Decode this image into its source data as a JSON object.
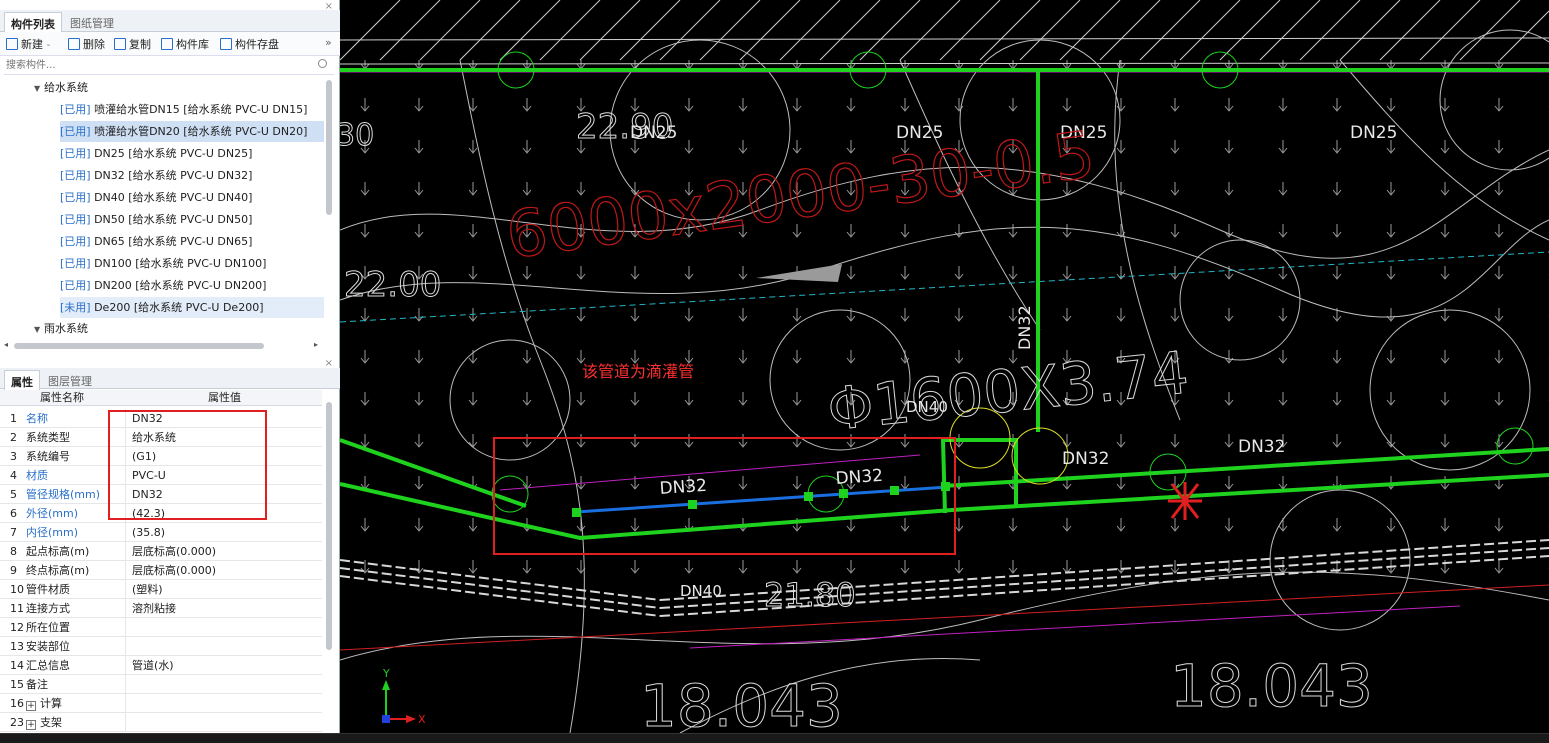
{
  "left_panel": {
    "top_tabs": [
      "构件列表",
      "图纸管理"
    ],
    "toolbar": {
      "new": "新建",
      "new_caret": "-",
      "delete": "删除",
      "copy": "复制",
      "library": "构件库",
      "save": "构件存盘",
      "more": "»"
    },
    "search_placeholder": "搜索构件...",
    "tree": {
      "group1": "给水系统",
      "items": [
        {
          "tag": "[已用]",
          "text": " 喷灌给水管DN15 [给水系统 PVC-U DN15]"
        },
        {
          "tag": "[已用]",
          "text": " 喷灌给水管DN20 [给水系统 PVC-U DN20]"
        },
        {
          "tag": "[已用]",
          "text": " DN25 [给水系统 PVC-U DN25]"
        },
        {
          "tag": "[已用]",
          "text": " DN32 [给水系统 PVC-U DN32]"
        },
        {
          "tag": "[已用]",
          "text": " DN40 [给水系统 PVC-U DN40]"
        },
        {
          "tag": "[已用]",
          "text": " DN50 [给水系统 PVC-U DN50]"
        },
        {
          "tag": "[已用]",
          "text": " DN65 [给水系统 PVC-U DN65]"
        },
        {
          "tag": "[已用]",
          "text": " DN100 [给水系统 PVC-U DN100]"
        },
        {
          "tag": "[已用]",
          "text": " DN200 [给水系统 PVC-U DN200]"
        },
        {
          "tag": "[未用]",
          "text": " De200 [给水系统 PVC-U De200]"
        }
      ],
      "group2": "雨水系统"
    },
    "bottom_tabs": [
      "属性",
      "图层管理"
    ],
    "prop_headers": [
      "属性名称",
      "属性值"
    ],
    "properties": [
      {
        "n": "1",
        "name": "名称",
        "value": "DN32"
      },
      {
        "n": "2",
        "name": "系统类型",
        "value": "给水系统"
      },
      {
        "n": "3",
        "name": "系统编号",
        "value": "(G1)"
      },
      {
        "n": "4",
        "name": "材质",
        "value": "PVC-U"
      },
      {
        "n": "5",
        "name": "管径规格(mm)",
        "value": "DN32"
      },
      {
        "n": "6",
        "name": "外径(mm)",
        "value": "(42.3)"
      },
      {
        "n": "7",
        "name": "内径(mm)",
        "value": "(35.8)"
      },
      {
        "n": "8",
        "name": "起点标高(m)",
        "value": "层底标高(0.000)"
      },
      {
        "n": "9",
        "name": "终点标高(m)",
        "value": "层底标高(0.000)"
      },
      {
        "n": "10",
        "name": "管件材质",
        "value": "(塑料)"
      },
      {
        "n": "11",
        "name": "连接方式",
        "value": "溶剂粘接"
      },
      {
        "n": "12",
        "name": "所在位置",
        "value": ""
      },
      {
        "n": "13",
        "name": "安装部位",
        "value": ""
      },
      {
        "n": "14",
        "name": "汇总信息",
        "value": "管道(水)"
      },
      {
        "n": "15",
        "name": "备注",
        "value": ""
      },
      {
        "n": "16",
        "name": "计算",
        "value": ""
      },
      {
        "n": "23",
        "name": "支架",
        "value": ""
      }
    ]
  },
  "canvas": {
    "annotation": "该管道为滴灌管",
    "labels": {
      "dn25_a": "DN25",
      "dn25_b": "DN25",
      "dn25_c": "DN25",
      "dn25_d": "DN25",
      "dn32_v": "DN32",
      "dn32_a": "DN32",
      "dn32_b": "DN32",
      "dn32_c": "DN32",
      "dn32_d": "DN32",
      "dn40_a": "DN40",
      "dn40_b": "DN40",
      "elev_2290": "22.90",
      "elev_2200": "22.00",
      "elev_2180": "21.80",
      "elev_18043a": "18.043",
      "elev_18043b": "18.043",
      "num_30": "30",
      "big_red": "6000x2000-30-0.5",
      "big_phi": "Φ1600X3.74",
      "axis_x": "X",
      "axis_y": "Y"
    }
  },
  "colors": {
    "pipe_green": "#1ed21e",
    "pipe_blue": "#1a6fe0",
    "highlight_red": "#e02020",
    "cad_white": "#c8c8c8",
    "magenta": "#c020c0",
    "selection_blue": "#cfe0f5"
  }
}
